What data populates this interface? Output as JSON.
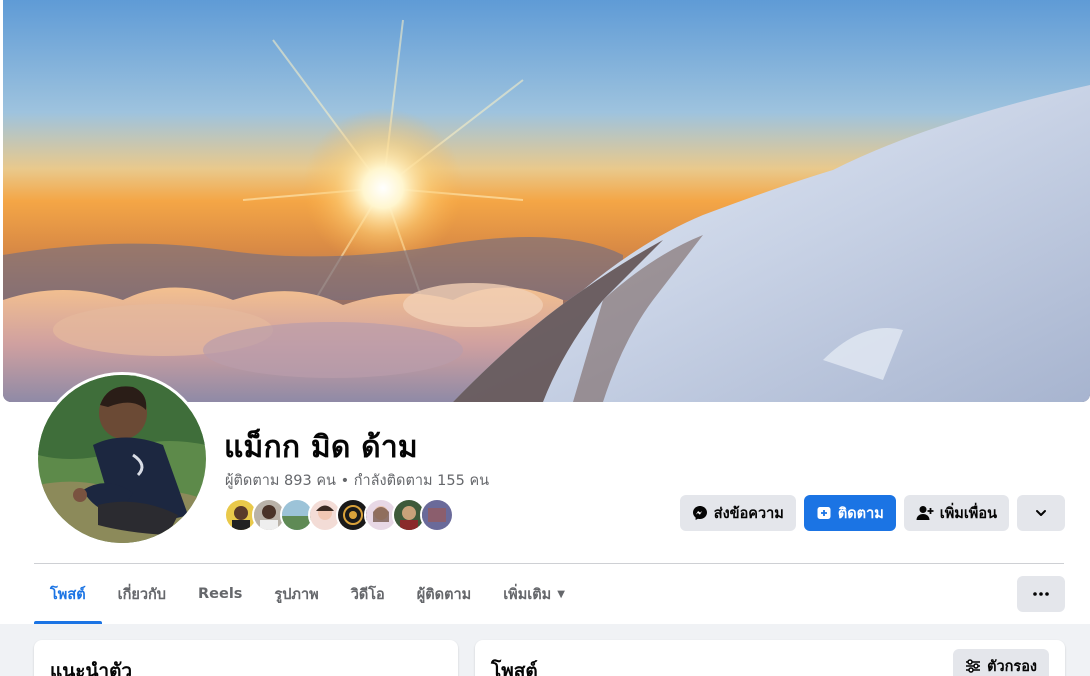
{
  "profile": {
    "name": "แม็กก มิด ด้าม",
    "followers_text": "ผู้ติดตาม 893 คน",
    "separator": "•",
    "following_text": "กำลังติดตาม 155 คน"
  },
  "actions": {
    "message_label": "ส่งข้อความ",
    "follow_label": "ติดตาม",
    "add_friend_label": "เพิ่มเพื่อน"
  },
  "tabs": [
    {
      "label": "โพสต์",
      "active": true
    },
    {
      "label": "เกี่ยวกับ"
    },
    {
      "label": "Reels"
    },
    {
      "label": "รูปภาพ"
    },
    {
      "label": "วิดีโอ"
    },
    {
      "label": "ผู้ติดตาม"
    },
    {
      "label": "เพิ่มเติม"
    }
  ],
  "intro": {
    "title": "แนะนำตัว"
  },
  "posts": {
    "title": "โพสต์",
    "filter_label": "ตัวกรอง"
  },
  "colors": {
    "accent": "#1b74e4",
    "secondary_text": "#65676b",
    "button_grey": "#e4e6eb"
  }
}
